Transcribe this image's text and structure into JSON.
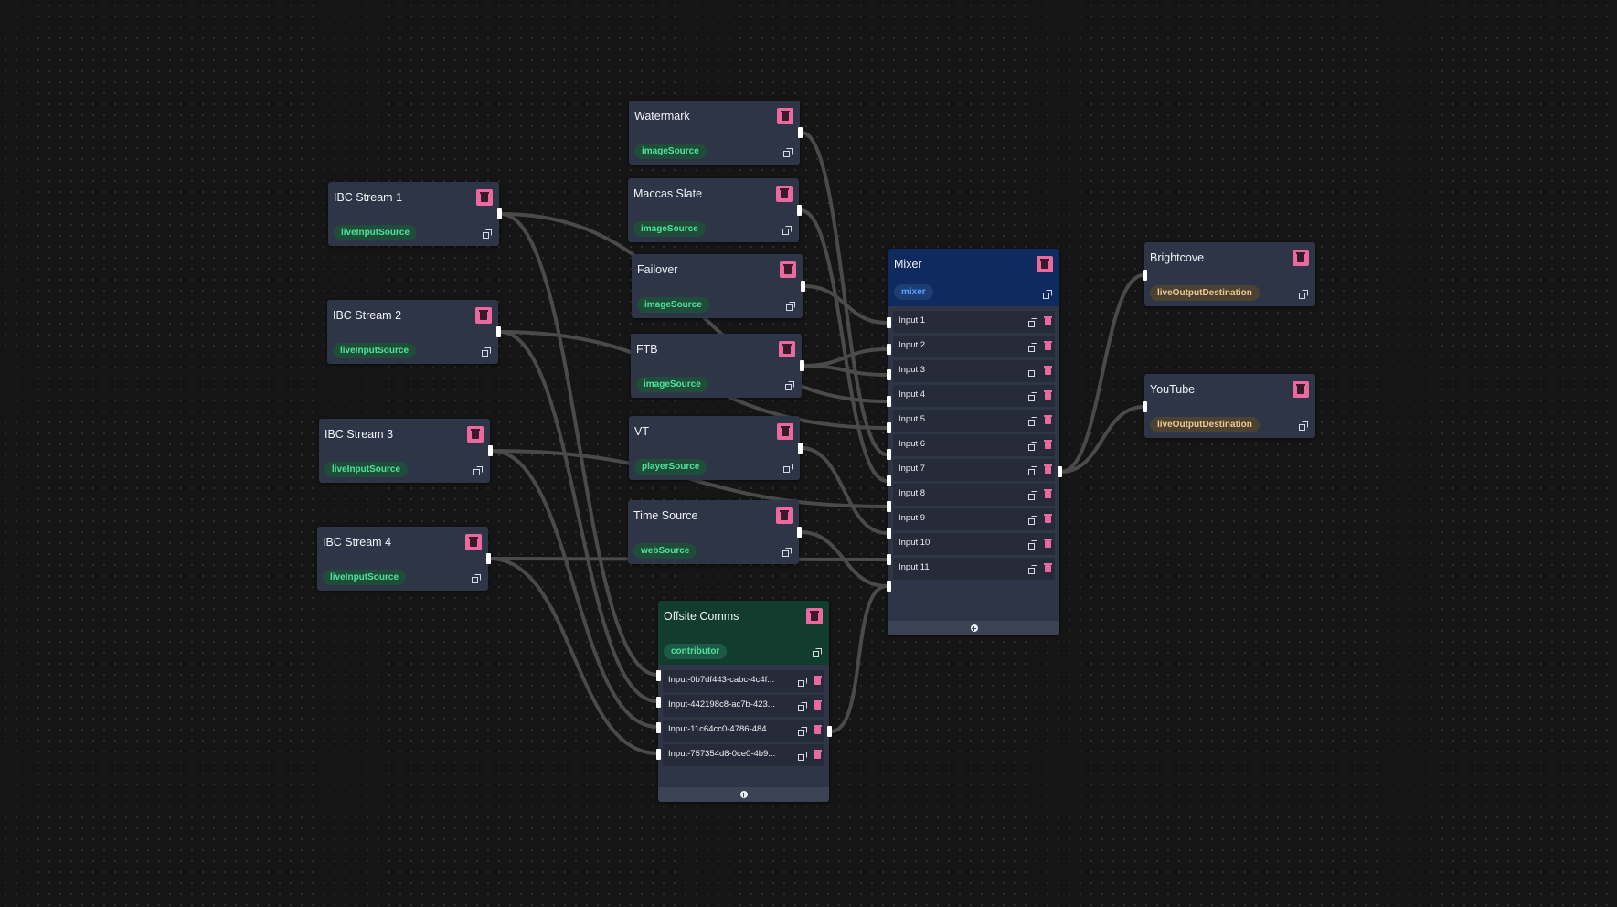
{
  "colors": {
    "background": "#151515",
    "node": "#2d3546",
    "mixer_header": "#0f2a5e",
    "contributor_header": "#123d2e",
    "delete_accent": "#ea6aa0",
    "edge": "#4a4a4a"
  },
  "icons": {
    "delete": "trash-icon",
    "duplicate": "copy-icon",
    "add": "plus-icon"
  },
  "nodes": {
    "ibc1": {
      "title": "IBC Stream 1",
      "type": "liveInputSource"
    },
    "ibc2": {
      "title": "IBC Stream 2",
      "type": "liveInputSource"
    },
    "ibc3": {
      "title": "IBC Stream 3",
      "type": "liveInputSource"
    },
    "ibc4": {
      "title": "IBC Stream 4",
      "type": "liveInputSource"
    },
    "watermark": {
      "title": "Watermark",
      "type": "imageSource"
    },
    "maccas": {
      "title": "Maccas Slate",
      "type": "imageSource"
    },
    "failover": {
      "title": "Failover",
      "type": "imageSource"
    },
    "ftb": {
      "title": "FTB",
      "type": "imageSource"
    },
    "vt": {
      "title": "VT",
      "type": "playerSource"
    },
    "time": {
      "title": "Time Source",
      "type": "webSource"
    },
    "offsite": {
      "title": "Offsite Comms",
      "type": "contributor",
      "inputs": [
        "Input-0b7df443-cabc-4c4f...",
        "Input-442198c8-ac7b-423...",
        "Input-11c64cc0-4786-484...",
        "Input-757354d8-0ce0-4b9..."
      ]
    },
    "mixer": {
      "title": "Mixer",
      "type": "mixer",
      "inputs": [
        "Input 1",
        "Input 2",
        "Input 3",
        "Input 4",
        "Input 5",
        "Input 6",
        "Input 7",
        "Input 8",
        "Input 9",
        "Input 10",
        "Input 11"
      ]
    },
    "brightcove": {
      "title": "Brightcove",
      "type": "liveOutputDestination"
    },
    "youtube": {
      "title": "YouTube",
      "type": "liveOutputDestination"
    }
  }
}
